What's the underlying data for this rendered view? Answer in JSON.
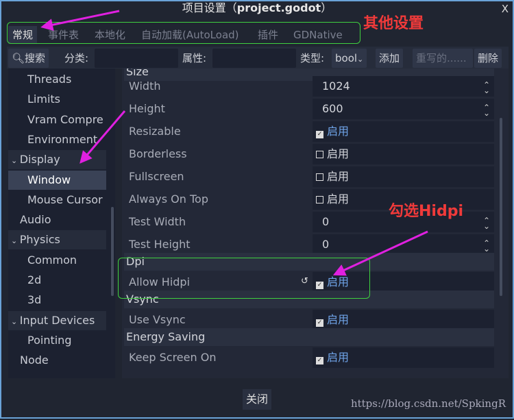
{
  "window": {
    "title_prefix": "项目设置（",
    "title_file": "project.godot",
    "title_suffix": "）",
    "close": "X"
  },
  "tabs": [
    {
      "label": "常规",
      "selected": true
    },
    {
      "label": "事件表"
    },
    {
      "label": "本地化"
    },
    {
      "label": "自动加载(AutoLoad)"
    },
    {
      "label": "插件"
    },
    {
      "label": "GDNative"
    }
  ],
  "toolbar": {
    "search": "搜索",
    "category_label": "分类:",
    "category_value": "",
    "property_label": "属性:",
    "property_value": "",
    "type_label": "类型:",
    "type_value": "bool",
    "add": "添加",
    "override": "重写的......",
    "delete": "删除"
  },
  "tree": [
    {
      "label": "Threads",
      "level": 2
    },
    {
      "label": "Limits",
      "level": 2
    },
    {
      "label": "Vram Compre",
      "level": 2
    },
    {
      "label": "Environment",
      "level": 2
    },
    {
      "label": "Display",
      "level": 1,
      "expanded": true
    },
    {
      "label": "Window",
      "level": 2,
      "selected": true
    },
    {
      "label": "Mouse Cursor",
      "level": 2
    },
    {
      "label": "Audio",
      "level": 1
    },
    {
      "label": "Physics",
      "level": 1,
      "expanded": true
    },
    {
      "label": "Common",
      "level": 2
    },
    {
      "label": "2d",
      "level": 2
    },
    {
      "label": "3d",
      "level": 2
    },
    {
      "label": "Input Devices",
      "level": 1,
      "expanded": true
    },
    {
      "label": "Pointing",
      "level": 2
    },
    {
      "label": "Node",
      "level": 1
    }
  ],
  "properties": [
    {
      "type": "header",
      "label": "Size"
    },
    {
      "label": "Width",
      "value": "1024",
      "spin": true
    },
    {
      "label": "Height",
      "value": "600",
      "spin": true
    },
    {
      "label": "Resizable",
      "checked": true,
      "value": "启用"
    },
    {
      "label": "Borderless",
      "checked": false,
      "value": "启用"
    },
    {
      "label": "Fullscreen",
      "checked": false,
      "value": "启用"
    },
    {
      "label": "Always On Top",
      "checked": false,
      "value": "启用"
    },
    {
      "label": "Test Width",
      "value": "0",
      "spin": true
    },
    {
      "label": "Test Height",
      "value": "0",
      "spin": true
    },
    {
      "type": "header",
      "label": "Dpi"
    },
    {
      "label": "Allow Hidpi",
      "checked": true,
      "value": "启用",
      "revert": true
    },
    {
      "type": "header",
      "label": "Vsync"
    },
    {
      "label": "Use Vsync",
      "checked": true,
      "value": "启用"
    },
    {
      "type": "header",
      "label": "Energy Saving"
    },
    {
      "label": "Keep Screen On",
      "checked": true,
      "value": "启用"
    }
  ],
  "footer": {
    "close": "关闭",
    "watermark": "https://blog.csdn.net/SpkingR"
  },
  "annotations": {
    "other_settings": "其他设置",
    "check_hidpi": "勾选Hidpi",
    "color": "#f03a3a",
    "arrow_color": "#e020e0"
  },
  "colors": {
    "accent": "#6fa4e8",
    "background": "#202531"
  }
}
